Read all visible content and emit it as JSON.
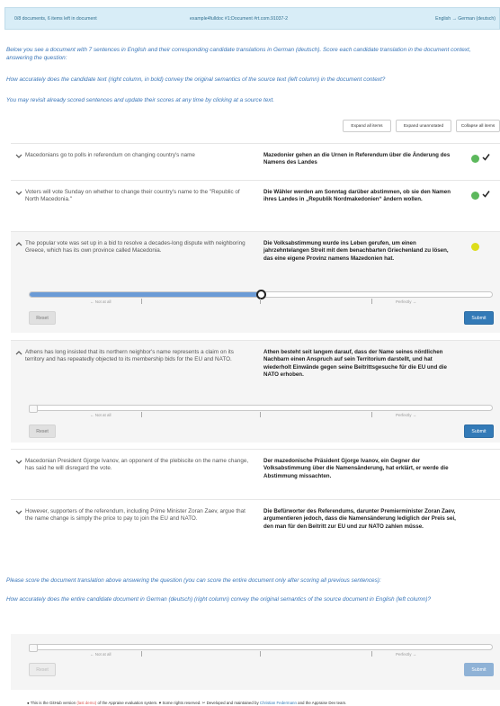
{
  "status": {
    "left": "0/8 documents, 6 items left in document",
    "mid": "example4fulldoc #1:Document #rt.com.91037-2",
    "right": "English → German (deutsch)"
  },
  "instructions": {
    "line1": "Below you see a document with 7 sentences in English and their corresponding candidate translations in German (deutsch). Score each candidate translation in the document context, answering the question:",
    "line2": "How accurately does the candidate text (right column, in bold) convey the original semantics of the source text (left column) in the document context?",
    "line3": "You may revisit already scored sentences and update their scores at any time by clicking at a source text."
  },
  "toolbar": {
    "expand_all": "Expand all items",
    "expand_unannotated": "Expand unannotated",
    "collapse_all": "Collapse all items"
  },
  "rows": [
    {
      "source": "Macedonians go to polls in referendum on changing country's name",
      "target": "Mazedonier gehen an die Urnen in Referendum über die Änderung des Namens des Landes",
      "status": "done"
    },
    {
      "source": "Voters will vote Sunday on whether to change their country's name to the \"Republic of North Macedonia.\"",
      "target": "Die Wähler werden am Sonntag darüber abstimmen, ob sie den Namen ihres Landes in „Republik Nordmakedonien“ ändern wollen.",
      "status": "done"
    },
    {
      "source": "The popular vote was set up in a bid to resolve a decades-long dispute with neighboring Greece, which has its own province called Macedonia.",
      "target": "Die Volksabstimmung wurde ins Leben gerufen, um einen jahrzehntelangen Streit mit dem benachbarten Griechenland zu lösen, das eine eigene Provinz namens Mazedonien hat.",
      "status": "in-progress",
      "score": 0.5
    },
    {
      "source": "Athens has long insisted that its northern neighbor's name represents a claim on its territory and has repeatedly objected to its membership bids for the EU and NATO.",
      "target": "Athen besteht seit langem darauf, dass der Name seines nördlichen Nachbarn einen Anspruch auf sein Territorium darstellt, und hat wiederholt Einwände gegen seine Beitrittsgesuche für die EU und die NATO erhoben."
    },
    {
      "source": "Macedonian President Gjorge Ivanov, an opponent of the plebiscite on the name change, has said he will disregard the vote.",
      "target": "Der mazedonische Präsident Gjorge Ivanov, ein Gegner der Volksabstimmung über die Namensänderung, hat erklärt, er werde die Abstimmung missachten."
    },
    {
      "source": "However, supporters of the referendum, including Prime Minister Zoran Zaev, argue that the name change is simply the price to pay to join the EU and NATO.",
      "target": "Die Befürworter des Referendums, darunter Premierminister Zoran Zaev, argumentieren jedoch, dass die Namensänderung lediglich der Preis sei, den man für den Beitritt zur EU und zur NATO zahlen müsse."
    }
  ],
  "scale": {
    "low": "← Not at all",
    "high": "Perfectly →"
  },
  "buttons": {
    "reset": "Reset",
    "submit": "Submit"
  },
  "doc_prompt": {
    "line1": "Please score the document translation above answering the question (you can score the entire document only after scoring all previous sentences):",
    "line2": "How accurately does the entire candidate document in German (deutsch) (right column) convey the original semantics of the source document in English (left column)?"
  },
  "footer": {
    "t1": "This is the GitHub version",
    "t2": "(last demo)",
    "t3": "of the Appraise evaluation system.",
    "t4": "Some rights reserved.",
    "t5": "Developed and maintained by",
    "t6": "Christian Federmann",
    "t7": "and the Appraise Dev team."
  },
  "colors": {
    "done": "#5cb85c",
    "in_progress": "#dddd1a",
    "accent": "#337ab7"
  }
}
